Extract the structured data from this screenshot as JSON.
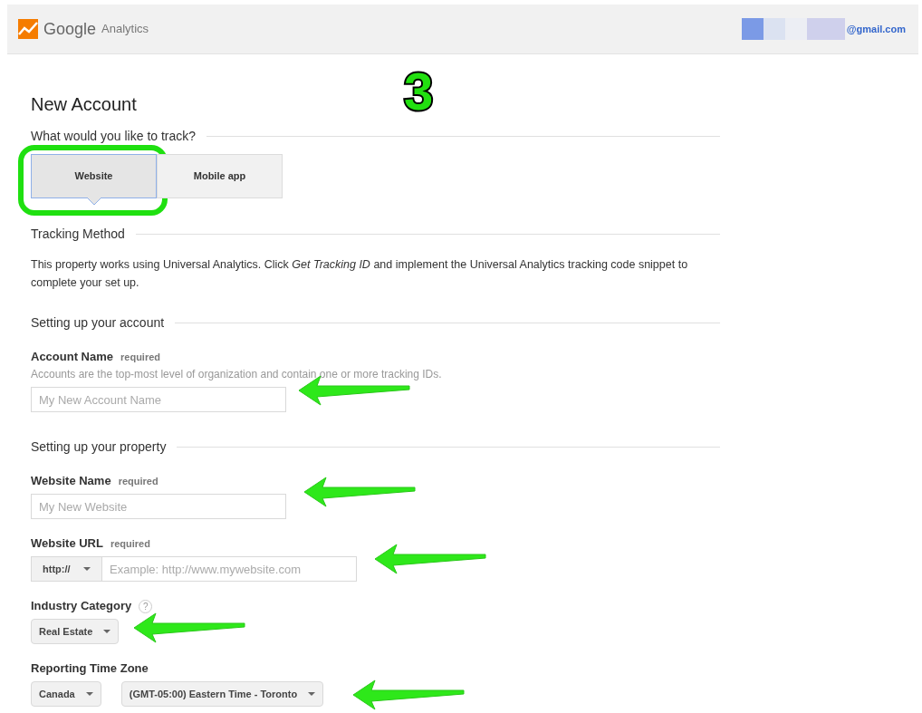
{
  "header": {
    "brand": "Google",
    "product": "Analytics",
    "account": "@gmail.com"
  },
  "annotation": {
    "number": "3"
  },
  "title": "New Account",
  "track": {
    "heading": "What would you like to track?",
    "options": [
      {
        "label": "Website",
        "selected": true,
        "highlighted": true
      },
      {
        "label": "Mobile app",
        "selected": false,
        "highlighted": false
      }
    ]
  },
  "tracking_method": {
    "heading": "Tracking Method",
    "text": "This property works using Universal Analytics. Click *Get Tracking ID* and implement the Universal Analytics tracking code snippet to complete your set up."
  },
  "sections": [
    {
      "heading": "Setting up your account",
      "fields": [
        {
          "label": "Account Name",
          "arrow": true,
          "required": "required",
          "help": "Accounts are the top-most level of organization and contain one or more tracking IDs.",
          "controls": [
            {
              "kind": "input",
              "placeholder": "My New Account Name"
            }
          ]
        }
      ]
    },
    {
      "heading": "Setting up your property",
      "fields": [
        {
          "label": "Website Name",
          "arrow": true,
          "required": "required",
          "controls": [
            {
              "kind": "input",
              "placeholder": "My New Website"
            }
          ]
        },
        {
          "label": "Website URL",
          "arrow": true,
          "required": "required",
          "controls": [
            {
              "kind": "prefix",
              "value": "http://"
            },
            {
              "kind": "input",
              "placeholder": "Example: http://www.mywebsite.com"
            }
          ]
        },
        {
          "label": "Industry Category",
          "arrow": true,
          "help_icon": "?",
          "controls": [
            {
              "kind": "select",
              "value": "Real Estate"
            }
          ]
        },
        {
          "label": "Reporting Time Zone",
          "arrow": true,
          "controls": [
            {
              "kind": "select",
              "value": "Canada"
            },
            {
              "kind": "select",
              "value": "(GMT-05:00) Eastern Time - Toronto"
            }
          ]
        }
      ]
    }
  ]
}
